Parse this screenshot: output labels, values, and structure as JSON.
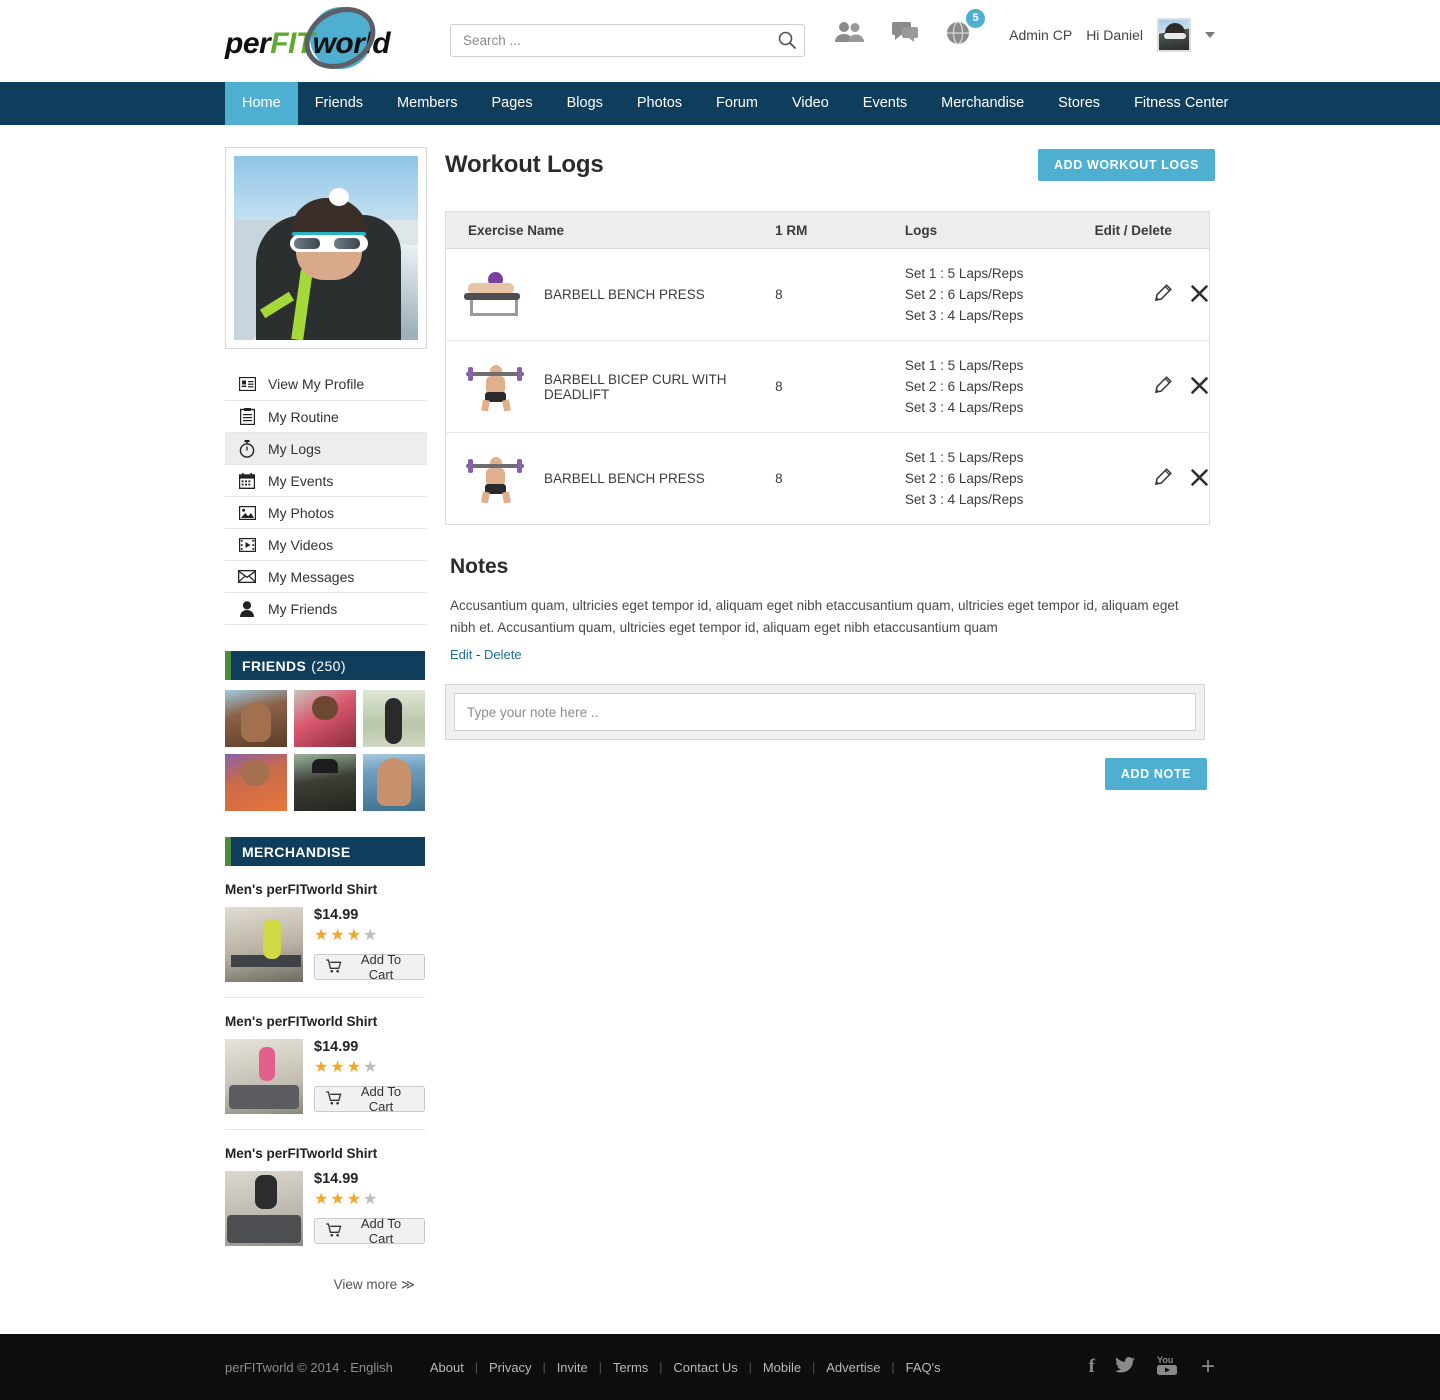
{
  "brand": {
    "name_part1": "per",
    "name_part2": "FIT",
    "name_part3": "world"
  },
  "search": {
    "placeholder": "Search ...",
    "value": "",
    "icon": "search-icon"
  },
  "header": {
    "friends_icon": "friends-icon",
    "messages_icon": "chat-icon",
    "globe_icon": "globe-notifications-icon",
    "notification_count": "5",
    "admin_link": "Admin CP",
    "greeting": "Hi Daniel",
    "avatar": "user-avatar",
    "caret": "chevron-down-icon"
  },
  "nav": {
    "items": [
      {
        "label": "Home",
        "active": true
      },
      {
        "label": "Friends",
        "active": false
      },
      {
        "label": "Members",
        "active": false
      },
      {
        "label": "Pages",
        "active": false
      },
      {
        "label": "Blogs",
        "active": false
      },
      {
        "label": "Photos",
        "active": false
      },
      {
        "label": "Forum",
        "active": false
      },
      {
        "label": "Video",
        "active": false
      },
      {
        "label": "Events",
        "active": false
      },
      {
        "label": "Merchandise",
        "active": false
      },
      {
        "label": "Stores",
        "active": false
      },
      {
        "label": "Fitness Center",
        "active": false
      }
    ]
  },
  "sidebar": {
    "profile_photo_alt": "profile-photo",
    "items": [
      {
        "label": "View My Profile",
        "icon": "id-card-icon",
        "active": false
      },
      {
        "label": "My Routine",
        "icon": "clipboard-icon",
        "active": false
      },
      {
        "label": "My Logs",
        "icon": "stopwatch-icon",
        "active": true
      },
      {
        "label": "My Events",
        "icon": "calendar-icon",
        "active": false
      },
      {
        "label": "My Photos",
        "icon": "image-icon",
        "active": false
      },
      {
        "label": "My Videos",
        "icon": "film-icon",
        "active": false
      },
      {
        "label": "My Messages",
        "icon": "envelope-icon",
        "active": false
      },
      {
        "label": "My Friends",
        "icon": "person-icon",
        "active": false
      }
    ],
    "friends_widget": {
      "title": "FRIENDS",
      "count": "(250)"
    },
    "merchandise_widget": {
      "title": "MERCHANDISE",
      "items": [
        {
          "title": "Men's perFITworld Shirt",
          "price": "$14.99",
          "rating": 3,
          "cart_label": "Add To Cart"
        },
        {
          "title": "Men's perFITworld Shirt",
          "price": "$14.99",
          "rating": 3,
          "cart_label": "Add To Cart"
        },
        {
          "title": "Men's perFITworld Shirt",
          "price": "$14.99",
          "rating": 3,
          "cart_label": "Add To Cart"
        }
      ],
      "view_more": "View more ≫"
    }
  },
  "main": {
    "title": "Workout Logs",
    "add_button": "ADD WORKOUT LOGS",
    "table": {
      "columns": [
        "Exercise Name",
        "1 RM",
        "Logs",
        "Edit / Delete"
      ],
      "rows": [
        {
          "thumb": "bench-press-thumb",
          "name": "BARBELL BENCH PRESS",
          "rm": "8",
          "logs": [
            "Set 1 : 5 Laps/Reps",
            "Set 2 : 6 Laps/Reps",
            "Set 3 : 4 Laps/Reps"
          ],
          "edit_icon": "pencil-icon",
          "delete_icon": "close-icon"
        },
        {
          "thumb": "barbell-lift-thumb",
          "name": "BARBELL BICEP CURL WITH DEADLIFT",
          "rm": "8",
          "logs": [
            "Set 1 : 5 Laps/Reps",
            "Set 2 : 6 Laps/Reps",
            "Set 3 : 4 Laps/Reps"
          ],
          "edit_icon": "pencil-icon",
          "delete_icon": "close-icon"
        },
        {
          "thumb": "barbell-lift-thumb",
          "name": "BARBELL BENCH PRESS",
          "rm": "8",
          "logs": [
            "Set 1 : 5 Laps/Reps",
            "Set 2 : 6 Laps/Reps",
            "Set 3 : 4 Laps/Reps"
          ],
          "edit_icon": "pencil-icon",
          "delete_icon": "close-icon"
        }
      ]
    },
    "notes": {
      "title": "Notes",
      "text": "Accusantium quam, ultricies eget tempor id, aliquam eget nibh etaccusantium quam, ultricies eget tempor id, aliquam eget nibh et. Accusantium quam, ultricies eget tempor id, aliquam eget nibh etaccusantium quam",
      "edit_label": "Edit",
      "separator": "-",
      "delete_label": "Delete",
      "input_placeholder": "Type your note here ..",
      "input_value": "",
      "add_button": "ADD NOTE"
    }
  },
  "footer": {
    "copyright": "perFITworld © 2014 . English",
    "links": [
      "About",
      "Privacy",
      "Invite",
      "Terms",
      "Contact Us",
      "Mobile",
      "Advertise",
      "FAQ's"
    ],
    "social": [
      {
        "name": "facebook-icon",
        "glyph": "f"
      },
      {
        "name": "twitter-icon",
        "glyph": "🐦"
      },
      {
        "name": "youtube-icon",
        "glyph": "You"
      },
      {
        "name": "googleplus-icon",
        "glyph": "+"
      }
    ]
  },
  "colors": {
    "accent": "#4FAFD0",
    "navy": "#0e3e5c",
    "green": "#4b8b3b",
    "star_on": "#f5a623",
    "star_off": "#bdbdbd"
  }
}
